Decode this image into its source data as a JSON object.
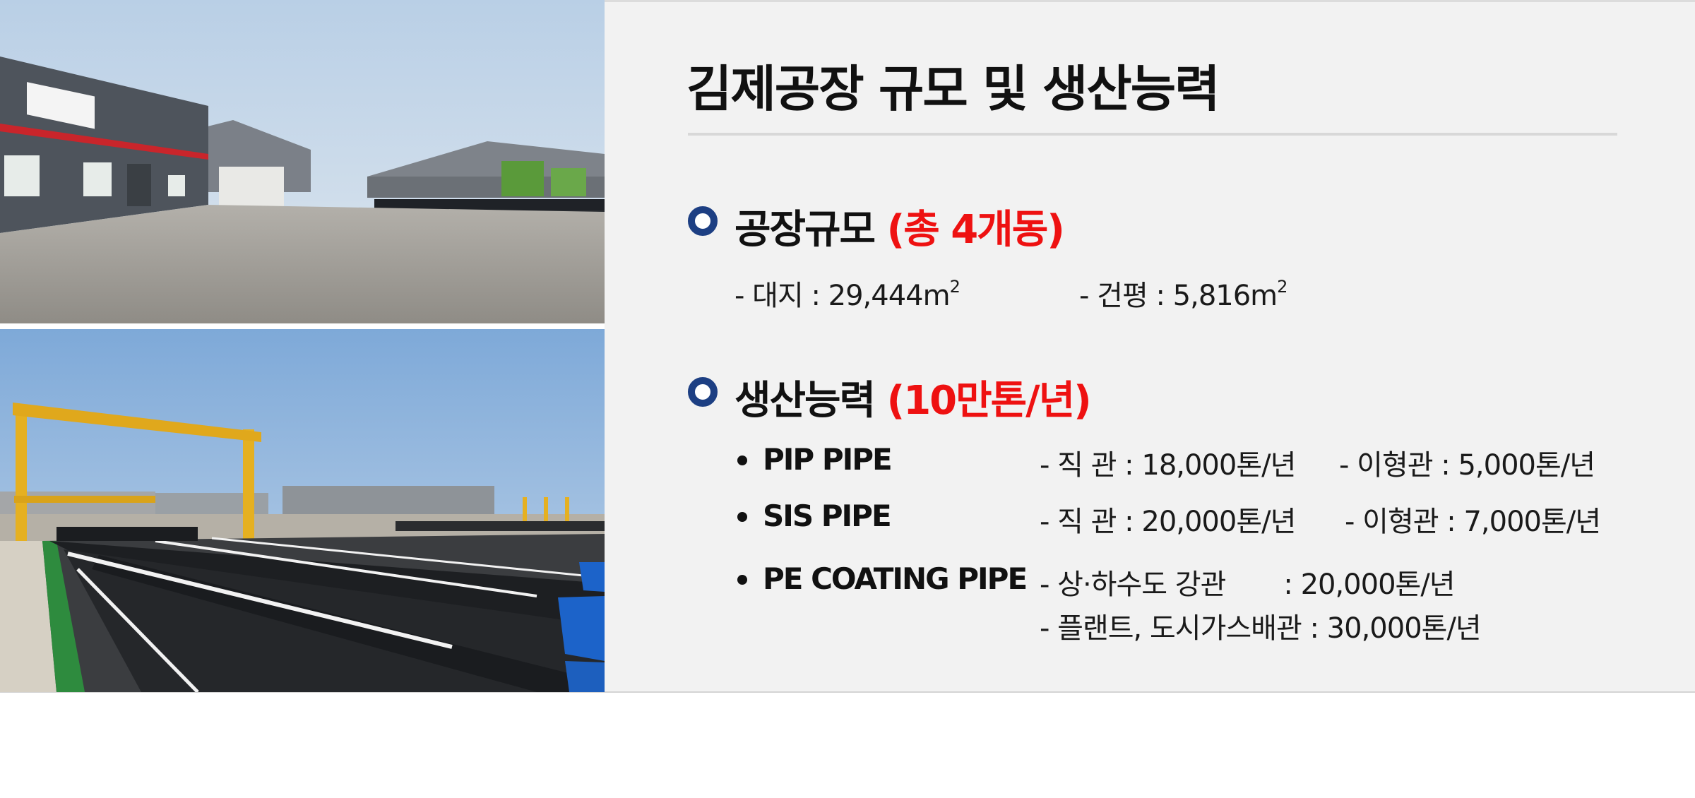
{
  "title": "김제공장 규모 및 생산능력",
  "sections": [
    {
      "heading": "공장규모",
      "accent": "(총 4개동)",
      "items": [
        {
          "label": "-  대지 : 29,444m",
          "sup": "2"
        },
        {
          "label": "-  건평 : 5,816m",
          "sup": "2"
        }
      ]
    },
    {
      "heading": "생산능력",
      "accent": "(10만톤/년)",
      "products": [
        {
          "name": "PIP PIPE",
          "detail_1": "- 직   관 : 18,000톤/년",
          "detail_2": "- 이형관 :   5,000톤/년"
        },
        {
          "name": "SIS PIPE",
          "detail_1": "- 직   관 : 20,000톤/년",
          "detail_2": "- 이형관 :   7,000톤/년"
        },
        {
          "name": "PE COATING PIPE",
          "detail_1": "- 상·하수도 강관       : 20,000톤/년",
          "detail_2": "- 플랜트, 도시가스배관 : 30,000톤/년"
        }
      ]
    }
  ],
  "colors": {
    "accent": "#ee1111",
    "bullet": "#1d3f83",
    "panel": "#f2f2f2"
  },
  "icons": [
    "ring-bullet-icon",
    "dot-bullet-icon"
  ]
}
